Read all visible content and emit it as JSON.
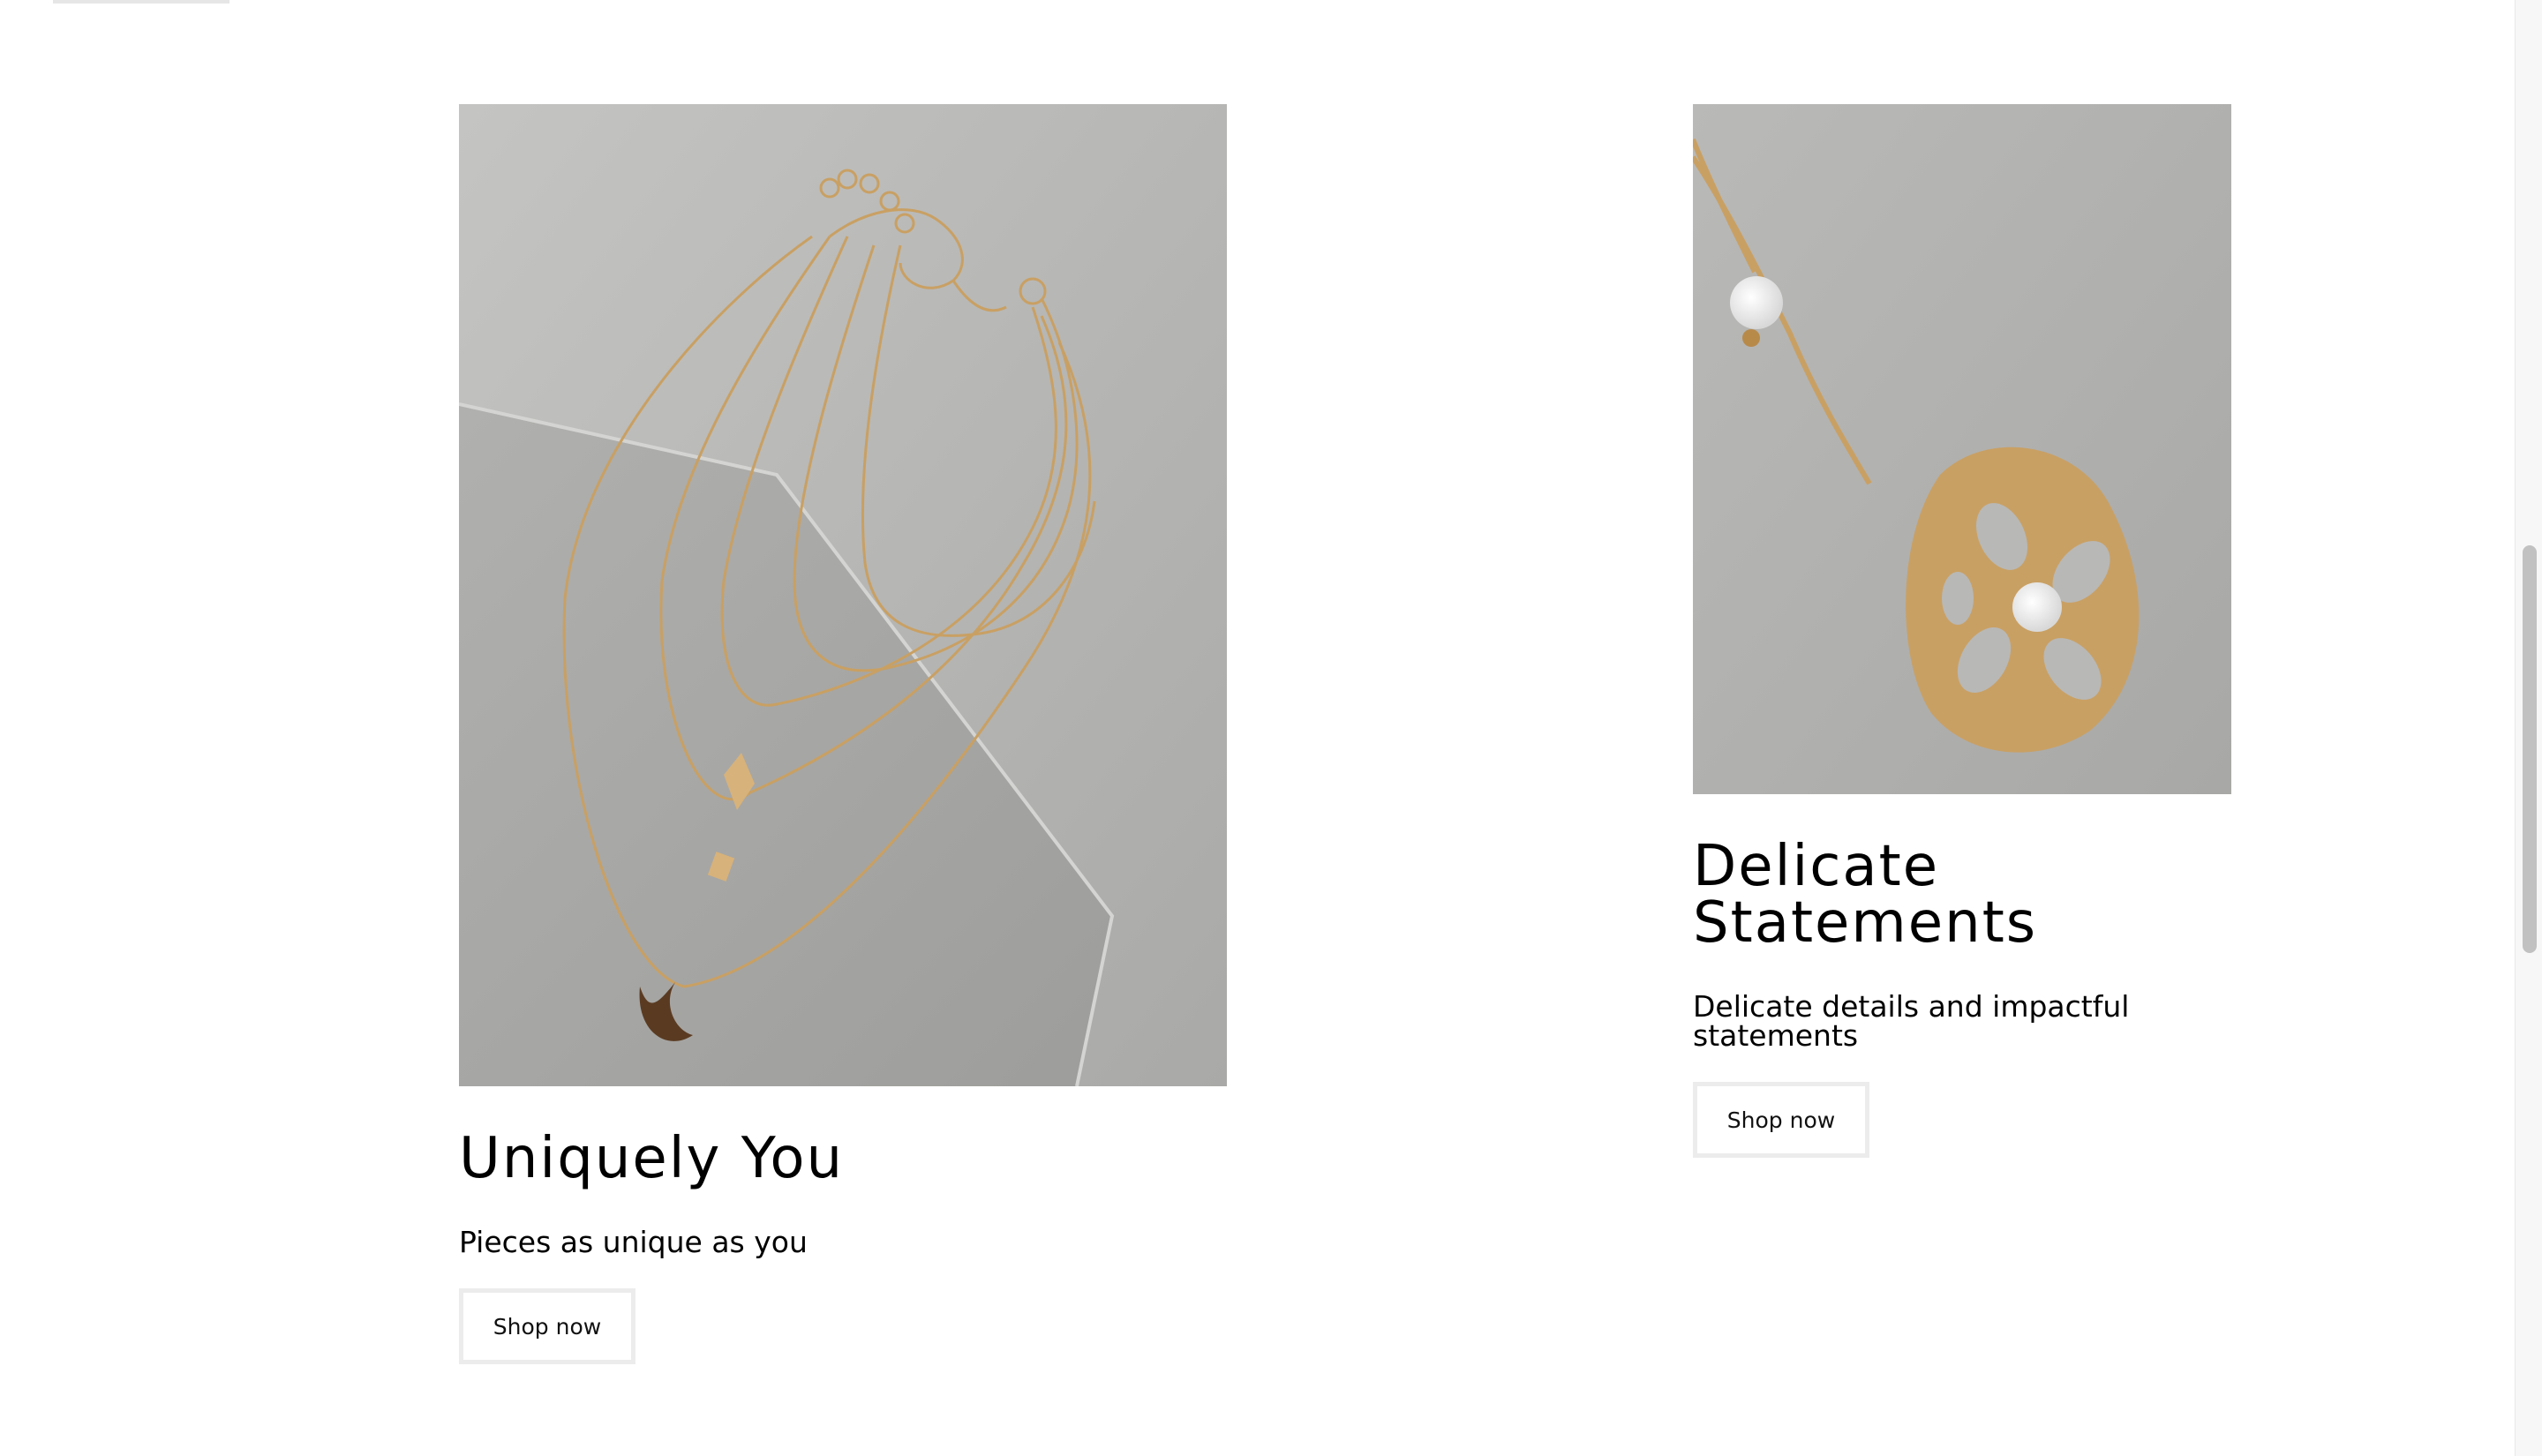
{
  "cards": [
    {
      "title": "Uniquely You",
      "description": "Pieces as unique as you",
      "button_label": "Shop now",
      "image_icon": "layered-necklace-image"
    },
    {
      "title": "Delicate Statements",
      "description": "Delicate details and impactful statements",
      "button_label": "Shop now",
      "image_icon": "filigree-pendant-image"
    }
  ],
  "colors": {
    "background": "#ffffff",
    "text": "#000000",
    "button_border": "#ececec",
    "stone": "#b7b7b5",
    "gold": "#c9a063"
  }
}
